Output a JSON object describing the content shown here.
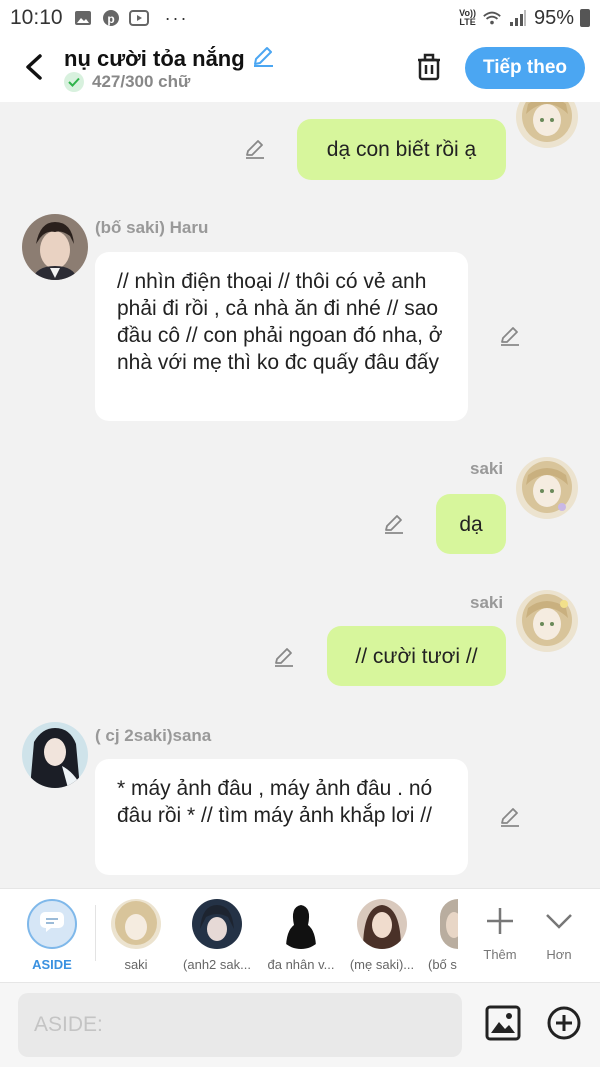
{
  "status": {
    "time": "10:10",
    "more": "···",
    "volte": "Vo)) LTE",
    "battery": "95%"
  },
  "header": {
    "title": "nụ cười tỏa nắng",
    "word_count": "427/300 chữ",
    "next_button": "Tiếp theo"
  },
  "messages": [
    {
      "side": "right",
      "sender": "saki",
      "text": "dạ con biết rồi ạ"
    },
    {
      "side": "left",
      "sender": "(bố saki) Haru",
      "text": "// nhìn điện thoại // thôi có vẻ anh phải đi rồi , cả nhà ăn đi nhé // sao đầu cô // con phải ngoan đó nha, ở nhà với mẹ thì ko đc quấy đâu đấy"
    },
    {
      "side": "right",
      "sender": "saki",
      "text": "dạ"
    },
    {
      "side": "right",
      "sender": "saki",
      "text": "// cười tươi //"
    },
    {
      "side": "left",
      "sender": "( cj 2saki)sana",
      "text": "* máy ảnh đâu , máy ảnh đâu . nó đâu rồi * // tìm máy ảnh khắp lơi //"
    }
  ],
  "characters": {
    "aside_label": "ASIDE",
    "items": [
      {
        "label": "saki"
      },
      {
        "label": "(anh2 sak..."
      },
      {
        "label": "đa nhân v..."
      },
      {
        "label": "(mẹ saki)..."
      },
      {
        "label": "(bố s"
      }
    ],
    "add_label": "Thêm",
    "more_label": "Hơn"
  },
  "input": {
    "placeholder": "ASIDE:"
  },
  "colors": {
    "accent": "#4ba6f2",
    "bubble_right": "#d7f69c",
    "bubble_left": "#ffffff",
    "background": "#f2f2f2"
  },
  "icons": [
    "back-arrow-icon",
    "pencil-icon",
    "check-icon",
    "trash-icon",
    "edit-icon",
    "chat-bubble-icon",
    "plus-icon",
    "chevron-down-icon",
    "image-icon",
    "add-circle-icon"
  ]
}
